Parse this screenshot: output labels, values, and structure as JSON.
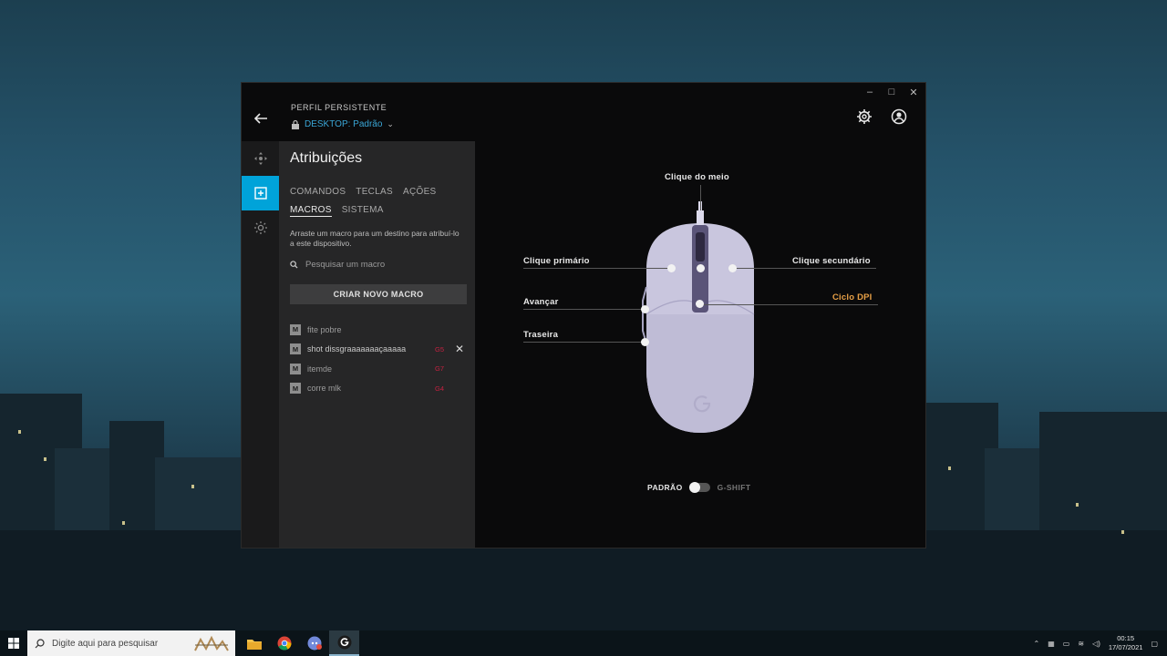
{
  "window": {
    "controls": {
      "minimize": "–",
      "maximize": "□",
      "close": "✕"
    },
    "profile_label": "PERFIL PERSISTENTE",
    "profile_value": "DESKTOP: Padrão"
  },
  "rail": {
    "items": [
      {
        "icon": "move-icon",
        "active": false
      },
      {
        "icon": "plus-square-icon",
        "active": true
      },
      {
        "icon": "sun-icon",
        "active": false
      }
    ]
  },
  "panel": {
    "title": "Atribuições",
    "tabs_row1": [
      "COMANDOS",
      "TECLAS",
      "AÇÕES"
    ],
    "tabs_row2": [
      "MACROS",
      "SISTEMA"
    ],
    "active_tab": "MACROS",
    "hint": "Arraste um macro para um destino para atribuí-lo a este dispositivo.",
    "search_placeholder": "Pesquisar um macro",
    "create_button": "CRIAR NOVO MACRO",
    "macros": [
      {
        "badge": "M",
        "name": "fite pobre",
        "key": ""
      },
      {
        "badge": "M",
        "name": "shot dissgraaaaaaaçaaaaa",
        "key": "G5"
      },
      {
        "badge": "M",
        "name": "itemde",
        "key": "G7"
      },
      {
        "badge": "M",
        "name": "corre mlk",
        "key": "G4"
      }
    ]
  },
  "mouse": {
    "labels": {
      "middle": "Clique do meio",
      "primary": "Clique primário",
      "secondary": "Clique secundário",
      "forward": "Avançar",
      "dpi": "Ciclo DPI",
      "back": "Traseira"
    },
    "body_color": "#c9c6de",
    "accent_color": "#e8a046",
    "mode_left": "PADRÃO",
    "mode_right": "G-SHIFT"
  },
  "taskbar": {
    "search_placeholder": "Digite aqui para pesquisar",
    "time": "00:15",
    "date": "17/07/2021"
  }
}
